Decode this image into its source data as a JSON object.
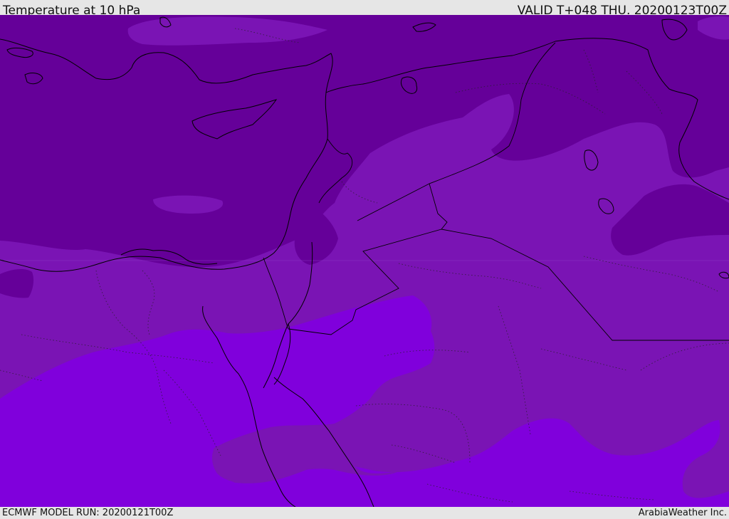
{
  "header": {
    "title": "Temperature at 10 hPa",
    "valid": "VALID T+048 THU. 20200123T00Z"
  },
  "footer": {
    "model_run": "ECMWF MODEL RUN: 20200121T00Z",
    "brand": "ArabiaWeather Inc."
  },
  "map": {
    "field": "temperature",
    "level": "10 hPa",
    "colors": {
      "coldest": "#650099",
      "cold": "#7a14b4",
      "cool": "#8000dc",
      "coastline": "#000000",
      "border": "#000000"
    },
    "icons": [
      "coastline",
      "country-border",
      "province-border"
    ]
  }
}
